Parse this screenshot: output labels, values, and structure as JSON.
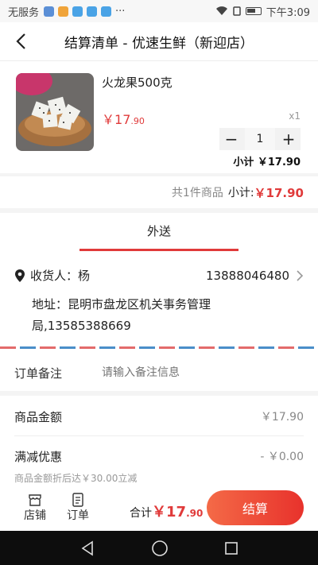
{
  "status_bar": {
    "carrier": "无服务",
    "time": "下午3:09",
    "more": "···"
  },
  "nav": {
    "title": "结算清单 - 优速生鲜（新迎店）"
  },
  "product": {
    "name": "火龙果500克",
    "price_symbol": "￥",
    "price_int": "17",
    "price_dec": ".90",
    "quantity_label": "x1",
    "quantity": "1",
    "minus": "−",
    "plus": "+",
    "subtotal": "小计 ￥17.90"
  },
  "summary": {
    "count_text": "共1件商品",
    "subtotal_label": "小计:",
    "subtotal_value": "￥17.90"
  },
  "delivery": {
    "tab_label": "外送",
    "receiver_label": "收货人：",
    "receiver_name": "杨",
    "phone": "13888046480",
    "address": "地址：昆明市盘龙区机关事务管理局,13585388669"
  },
  "remark": {
    "label": "订单备注",
    "placeholder": "请输入备注信息"
  },
  "amounts": {
    "goods_label": "商品金额",
    "goods_value": "￥17.90",
    "discount_label": "满减优惠",
    "discount_value": "- ￥0.00",
    "discount_note": "商品金额折后达￥30.00立减"
  },
  "bottom": {
    "store_label": "店铺",
    "order_label": "订单",
    "total_label": "合计",
    "total_symbol": "￥",
    "total_int": "17",
    "total_dec": ".90",
    "checkout_label": "结算"
  },
  "colors": {
    "accent": "#e03a3a",
    "checkout_start": "#f46a47",
    "checkout_end": "#e8322c"
  }
}
